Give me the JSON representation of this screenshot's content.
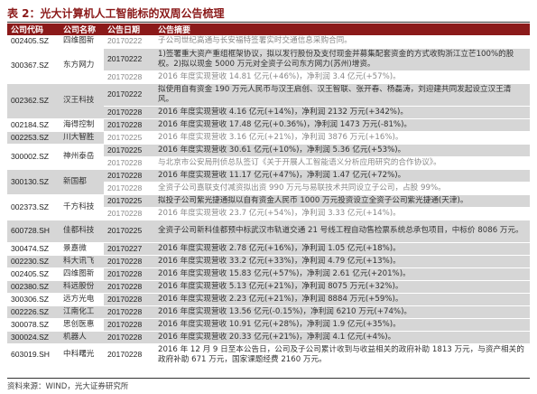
{
  "title": "表 2：光大计算机人工智能标的双周公告梳理",
  "headers": [
    "公司代码",
    "公司名称",
    "公告日期",
    "公告摘要"
  ],
  "rows": [
    {
      "code": "002405.SZ",
      "name": "四维图新",
      "date": "20170222",
      "summary": "子公司世纪高通与长安福特签署实时交通信息采购合同。"
    },
    {
      "code": "300367.SZ",
      "name": "东方网力",
      "date": "20170222",
      "summary": "1)签署重大资产重组框架协议，拟以发行股份及支付现金并募集配套资金的方式收购浙江立芒100%的股权。2)拟以现金 5000 万元对全资子公司东方网力(苏州)增资。"
    },
    {
      "code": "",
      "name": "",
      "date": "20170228",
      "summary": "2016 年度实现营收 14.81 亿元(+46%)，净利润 3.4 亿元(+57%)。"
    },
    {
      "code": "002362.SZ",
      "name": "汉王科技",
      "date": "20170222",
      "summary": "拟使用自有资金 190 万元人民币与汉王启创、汉王智联、张开春、杨磊涛，刘迎建共同发起设立汉王清风。"
    },
    {
      "code": "",
      "name": "",
      "date": "20170228",
      "summary": "2016 年度实现营收 4.16 亿元(+14%)，净利润 2132 万元(+342%)。"
    },
    {
      "code": "002184.SZ",
      "name": "海得控制",
      "date": "20170228",
      "summary": "2016 年度实现营收 17.48 亿元(+0.36%)，净利润 1473 万元(-81%)。"
    },
    {
      "code": "002253.SZ",
      "name": "川大智胜",
      "date": "20170225",
      "summary": "2016 年度实现营收 3.16 亿元(+21%)，净利润 3876 万元(+16%)。"
    },
    {
      "code": "300002.SZ",
      "name": "神州泰岳",
      "date": "20170225",
      "summary": "2016 年度实现营收 30.61 亿元(+10%)，净利润 5.36 亿元(+53%)。"
    },
    {
      "code": "",
      "name": "",
      "date": "20170228",
      "summary": "与北京市公安局刑侦总队签订《关于开展人工智能语义分析应用研究的合作协议》。"
    },
    {
      "code": "300130.SZ",
      "name": "新国都",
      "date": "20170228",
      "summary": "2016 年度实现营收 11.17 亿元(+47%)，净利润 1.47 亿元(+72%)。"
    },
    {
      "code": "",
      "name": "",
      "date": "20170228",
      "summary": "全资子公司嘉联支付减资拟出资 990 万元与易联技术共同设立子公司，占股 99%。"
    },
    {
      "code": "002373.SZ",
      "name": "千方科技",
      "date": "20170225",
      "summary": "拟投子公司紫光捷通拟以自有资金人民币 1000 万元投资设立全资子公司紫光捷通(天津)。"
    },
    {
      "code": "",
      "name": "",
      "date": "20170228",
      "summary": "2016 年度实现营收 23.7 亿元(+54%)，净利润 3.33 亿元(+14%)。"
    },
    {
      "code": "600728.SH",
      "name": "佳都科技",
      "date": "20170225",
      "summary": "全资子公司新科佳都预中标武汉市轨道交通 21 号线工程自动售检票系统总承包项目，中标价 8086 万元。"
    },
    {
      "code": "300474.SZ",
      "name": "景嘉微",
      "date": "20170227",
      "summary": "2016 年度实现营收 2.78 亿元(+16%)，净利润 1.05 亿元(+18%)。"
    },
    {
      "code": "002230.SZ",
      "name": "科大讯飞",
      "date": "20170228",
      "summary": "2016 年度实现营收 33.2 亿元(+33%)，净利润 4.79 亿元(+13%)。"
    },
    {
      "code": "002405.SZ",
      "name": "四维图新",
      "date": "20170228",
      "summary": "2016 年度实现营收 15.83 亿元(+57%)，净利润 2.61 亿元(+201%)。"
    },
    {
      "code": "002380.SZ",
      "name": "科远股份",
      "date": "20170228",
      "summary": "2016 年度实现营收 5.13 亿元(+21%)，净利润 8075 万元(+32%)。"
    },
    {
      "code": "300306.SZ",
      "name": "远方光电",
      "date": "20170228",
      "summary": "2016 年度实现营收 2.23 亿元(+21%)，净利润 8884 万元(+59%)。"
    },
    {
      "code": "002226.SZ",
      "name": "江南化工",
      "date": "20170228",
      "summary": "2016 年度实现营收 13.56 亿元(-0.15%)，净利润 6210 万元(+74%)。"
    },
    {
      "code": "300078.SZ",
      "name": "思创医惠",
      "date": "20170228",
      "summary": "2016 年度实现营收 10.91 亿元(+28%)，净利润 1.9 亿元(+35%)。"
    },
    {
      "code": "300024.SZ",
      "name": "机器人",
      "date": "20170228",
      "summary": "2016 年度实现营收 20.33 亿元(+21%)，净利润 4.1 亿元(+4%)。"
    },
    {
      "code": "603019.SH",
      "name": "中科曙光",
      "date": "20170228",
      "summary": "2016 年 12 月 9 日至本公告日，公司及子公司累计收到与收益相关的政府补助 1813 万元，与资产相关的政府补助 671 万元，国家课题经费 2160 万元。"
    }
  ],
  "source": "资料来源：WIND，光大证券研究所"
}
